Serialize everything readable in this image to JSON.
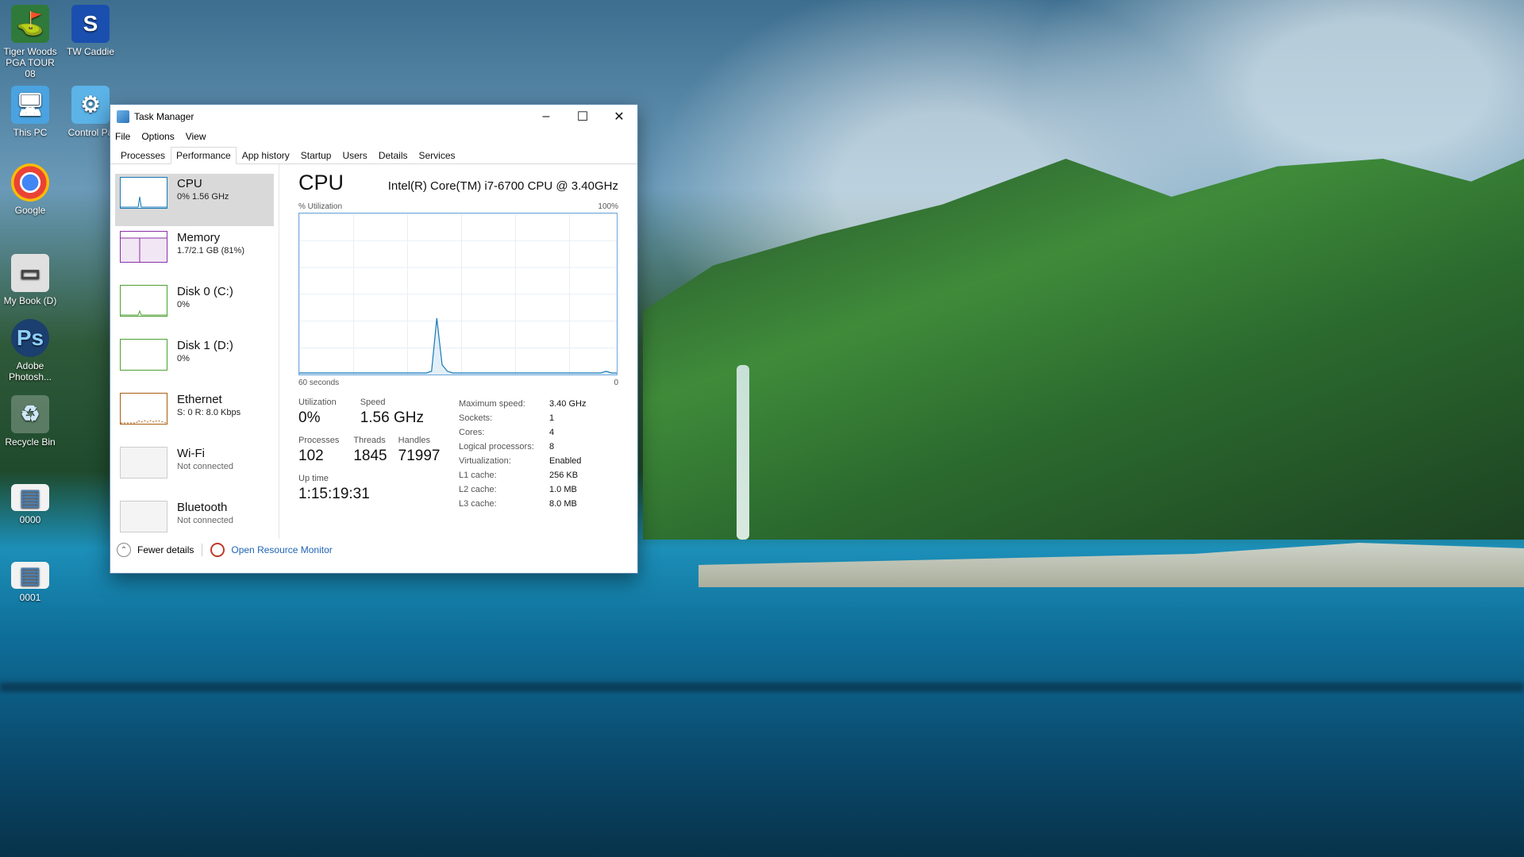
{
  "desktop": {
    "icons": [
      {
        "label": "Tiger Woods PGA TOUR 08",
        "icon": "golf-game-icon"
      },
      {
        "label": "TW Caddie",
        "icon": "tw-caddie-icon"
      },
      {
        "label": "This PC",
        "icon": "computer-icon"
      },
      {
        "label": "Control Pa",
        "icon": "control-panel-icon"
      },
      {
        "label": "Google",
        "icon": "chrome-icon"
      },
      {
        "label": "My Book (D)",
        "icon": "drive-icon"
      },
      {
        "label": "Adobe Photosh...",
        "icon": "photoshop-icon"
      },
      {
        "label": "Recycle Bin",
        "icon": "recycle-bin-icon"
      },
      {
        "label": "0000",
        "icon": "image-file-icon"
      },
      {
        "label": "0001",
        "icon": "image-file-icon"
      }
    ]
  },
  "window": {
    "title": "Task Manager",
    "controls": {
      "minimize": "–",
      "maximize": "☐",
      "close": "✕"
    },
    "menu": [
      "File",
      "Options",
      "View"
    ],
    "tabs": [
      "Processes",
      "Performance",
      "App history",
      "Startup",
      "Users",
      "Details",
      "Services"
    ],
    "active_tab": "Performance"
  },
  "sidebar": {
    "items": [
      {
        "name": "CPU",
        "sub": "0% 1.56 GHz",
        "color": "#1779ba"
      },
      {
        "name": "Memory",
        "sub": "1.7/2.1 GB (81%)",
        "color": "#8b2fa8"
      },
      {
        "name": "Disk 0 (C:)",
        "sub": "0%",
        "color": "#4da033"
      },
      {
        "name": "Disk 1 (D:)",
        "sub": "0%",
        "color": "#4da033"
      },
      {
        "name": "Ethernet",
        "sub": "S: 0 R: 8.0 Kbps",
        "color": "#a75e10"
      },
      {
        "name": "Wi-Fi",
        "sub": "Not connected",
        "color": "#bbbbbb"
      },
      {
        "name": "Bluetooth",
        "sub": "Not connected",
        "color": "#bbbbbb"
      }
    ]
  },
  "cpu": {
    "heading": "CPU",
    "model": "Intel(R) Core(TM) i7-6700 CPU @ 3.40GHz",
    "graph_top_left": "% Utilization",
    "graph_top_right": "100%",
    "graph_bottom_left": "60 seconds",
    "graph_bottom_right": "0",
    "stats": {
      "utilization_label": "Utilization",
      "utilization": "0%",
      "speed_label": "Speed",
      "speed": "1.56 GHz",
      "processes_label": "Processes",
      "processes": "102",
      "threads_label": "Threads",
      "threads": "1845",
      "handles_label": "Handles",
      "handles": "71997",
      "uptime_label": "Up time",
      "uptime": "1:15:19:31"
    },
    "specs": [
      {
        "k": "Maximum speed:",
        "v": "3.40 GHz"
      },
      {
        "k": "Sockets:",
        "v": "1"
      },
      {
        "k": "Cores:",
        "v": "4"
      },
      {
        "k": "Logical processors:",
        "v": "8"
      },
      {
        "k": "Virtualization:",
        "v": "Enabled"
      },
      {
        "k": "L1 cache:",
        "v": "256 KB"
      },
      {
        "k": "L2 cache:",
        "v": "1.0 MB"
      },
      {
        "k": "L3 cache:",
        "v": "8.0 MB"
      }
    ]
  },
  "chart_data": {
    "type": "line",
    "title": "",
    "xlabel": "",
    "ylabel": "% Utilization",
    "ylim": [
      0,
      100
    ],
    "xlim": [
      60,
      0
    ],
    "series": [
      {
        "values": [
          1,
          1,
          1,
          1,
          1,
          1,
          1,
          1,
          1,
          1,
          1,
          1,
          1,
          1,
          1,
          1,
          1,
          1,
          1,
          1,
          1,
          1,
          1,
          1,
          1,
          2,
          35,
          6,
          2,
          1,
          1,
          1,
          1,
          1,
          1,
          1,
          1,
          1,
          1,
          1,
          1,
          1,
          1,
          1,
          1,
          1,
          1,
          1,
          1,
          1,
          1,
          1,
          1,
          1,
          1,
          1,
          1,
          1,
          2,
          1,
          1
        ]
      }
    ]
  },
  "footer": {
    "fewer_details": "Fewer details",
    "open_resource_monitor": "Open Resource Monitor"
  }
}
